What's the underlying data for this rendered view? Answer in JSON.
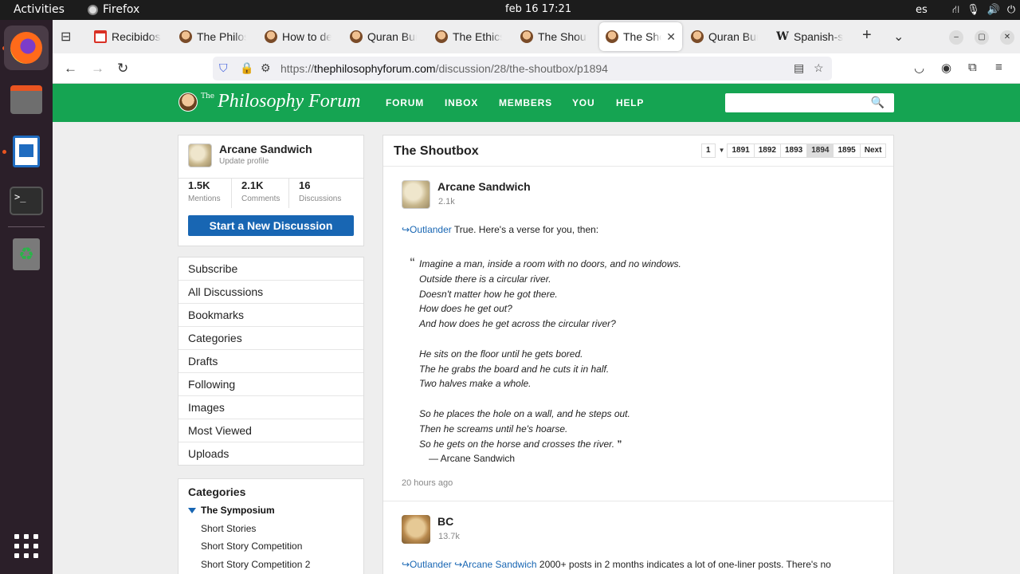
{
  "system": {
    "activities": "Activities",
    "app_name": "Firefox",
    "clock": "feb 16  17:21",
    "lang": "es"
  },
  "tabs": [
    {
      "label": "Recibidos",
      "favicon": "gmail-icon"
    },
    {
      "label": "The Philoso",
      "favicon": "forum-icon"
    },
    {
      "label": "How to def",
      "favicon": "forum-icon"
    },
    {
      "label": "Quran Burn",
      "favicon": "forum-icon"
    },
    {
      "label": "The Ethics",
      "favicon": "forum-icon"
    },
    {
      "label": "The Shoutb",
      "favicon": "forum-icon"
    },
    {
      "label": "The Shou",
      "favicon": "forum-icon",
      "active": true
    },
    {
      "label": "Quran Burn",
      "favicon": "forum-icon"
    },
    {
      "label": "Spanish-su",
      "favicon": "wikipedia-icon"
    }
  ],
  "url": {
    "prefix": "https://",
    "host": "thephilosophyforum.com",
    "path": "/discussion/28/the-shoutbox/p1894"
  },
  "site": {
    "logo_the": "The",
    "logo_name": "Philosophy Forum",
    "nav": [
      "FORUM",
      "INBOX",
      "MEMBERS",
      "YOU",
      "HELP"
    ],
    "search_placeholder": ""
  },
  "profile": {
    "name": "Arcane Sandwich",
    "update": "Update profile",
    "stats": [
      {
        "value": "1.5K",
        "label": "Mentions"
      },
      {
        "value": "2.1K",
        "label": "Comments"
      },
      {
        "value": "16",
        "label": "Discussions"
      }
    ],
    "new_discussion": "Start a New Discussion"
  },
  "menu": [
    "Subscribe",
    "All Discussions",
    "Bookmarks",
    "Categories",
    "Drafts",
    "Following",
    "Images",
    "Most Viewed",
    "Uploads"
  ],
  "categories": {
    "heading": "Categories",
    "group": "The Symposium",
    "items": [
      "Short Stories",
      "Short Story Competition",
      "Short Story Competition 2"
    ]
  },
  "discussion": {
    "title": "The Shoutbox",
    "pager": {
      "first": "1",
      "pages": [
        "1891",
        "1892",
        "1893",
        "1894",
        "1895"
      ],
      "current": "1894",
      "next": "Next"
    },
    "posts": [
      {
        "author": "Arcane Sandwich",
        "count": "2.1k",
        "mention": "↪Outlander",
        "text": " True. Here's a verse for you, then:",
        "quote": [
          "Imagine a man, inside a room with no doors, and no windows.",
          "Outside there is a circular river.",
          "Doesn't matter how he got there.",
          "How does he get out?",
          "And how does he get across the circular river?",
          "",
          "He sits on the floor until he gets bored.",
          "The he grabs the board and he cuts it in half.",
          "Two halves make a whole.",
          "",
          "So he places the hole on a wall, and he steps out.",
          "Then he screams until he's hoarse.",
          "So he gets on the horse and crosses the river."
        ],
        "attribution": "— Arcane Sandwich",
        "time": "20 hours ago"
      },
      {
        "author": "BC",
        "count": "13.7k",
        "mention1": "↪Outlander",
        "mention2": "↪Arcane Sandwich",
        "text": " 2000+ posts in 2 months indicates a lot of one-liner posts. There's no"
      }
    ]
  }
}
